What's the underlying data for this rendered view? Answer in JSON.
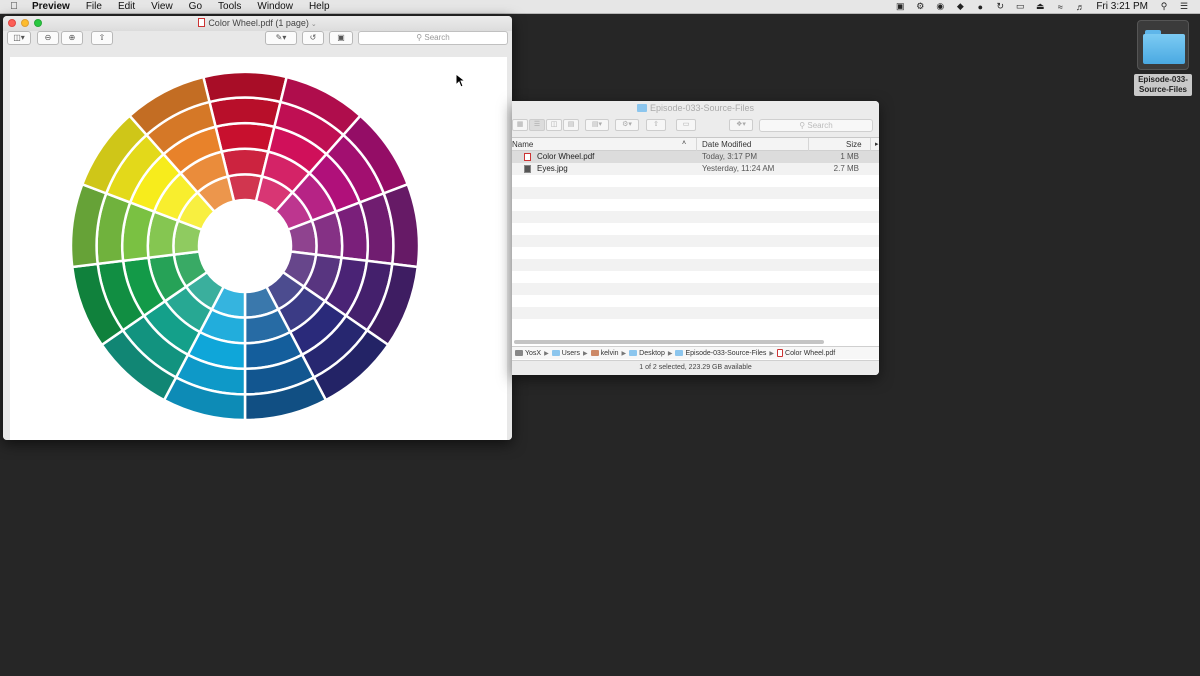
{
  "menubar": {
    "app": "Preview",
    "items": [
      "File",
      "Edit",
      "View",
      "Go",
      "Tools",
      "Window",
      "Help"
    ],
    "clock": "Fri 3:21 PM"
  },
  "desktop": {
    "folder_label": "Episode-033-Source-Files"
  },
  "preview": {
    "title": "Color Wheel.pdf (1 page)",
    "search_placeholder": "Search"
  },
  "finder": {
    "title": "Episode-033-Source-Files",
    "search_placeholder": "Search",
    "columns": {
      "name": "Name",
      "date": "Date Modified",
      "size": "Size"
    },
    "files": [
      {
        "name": "Color Wheel.pdf",
        "date": "Today, 3:17 PM",
        "size": "1 MB",
        "kind": "pdf"
      },
      {
        "name": "Eyes.jpg",
        "date": "Yesterday, 11:24 AM",
        "size": "2.7 MB",
        "kind": "jpg"
      }
    ],
    "path": [
      "YosX",
      "Users",
      "kelvin",
      "Desktop",
      "Episode-033-Source-Files",
      "Color Wheel.pdf"
    ],
    "status": "1 of 2 selected, 223.29 GB available"
  },
  "wheel": {
    "colors": [
      "#c8102e",
      "#d0105a",
      "#b0107a",
      "#7a1f7a",
      "#4a2375",
      "#2a2a7a",
      "#145e9c",
      "#0fa6d9",
      "#14a08a",
      "#139a48",
      "#7ac142",
      "#f7ec1c",
      "#e8822a"
    ]
  }
}
